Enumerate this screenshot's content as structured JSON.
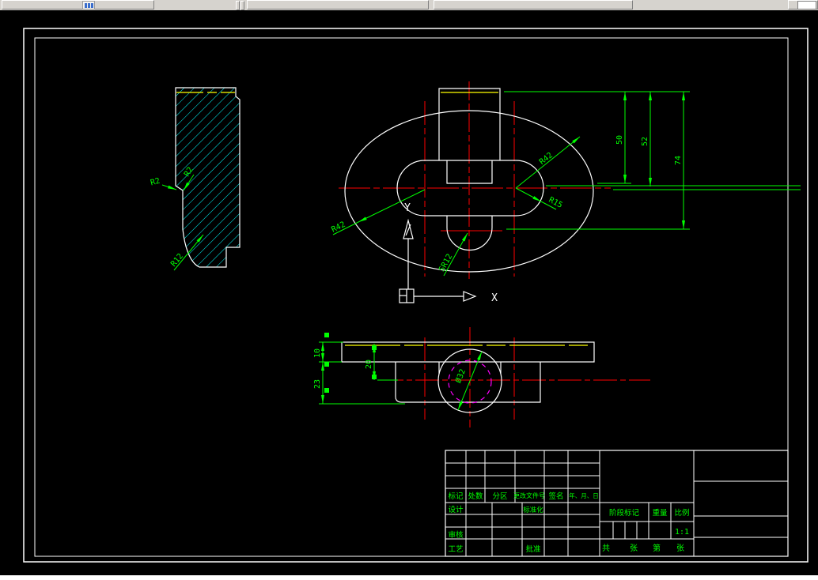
{
  "dims": {
    "sec_r2a": "R2",
    "sec_r2b": "R2",
    "sec_r12": "R12",
    "tv_r42_upper": "R42",
    "tv_r42_lower": "R42",
    "tv_r15": "R15",
    "tv_sr12": "SR12",
    "tv_50": "50",
    "tv_52": "52",
    "tv_74": "74",
    "bv_10": "10",
    "bv_23": "23",
    "bv_20": "20",
    "bv_dia": "Ø32"
  },
  "ucs": {
    "x": "X",
    "y": "Y"
  },
  "title_block": {
    "header": [
      "标记",
      "处数",
      "分区",
      "更改文件号",
      "签名",
      "年、月、日"
    ],
    "design": "设计",
    "standardization": "标准化",
    "check": "审核",
    "process": "工艺",
    "approve": "批准",
    "stage_mark": "阶段标记",
    "weight": "重量",
    "scale_label": "比例",
    "scale_value": "1:1",
    "total": "共",
    "sheet1": "张",
    "ordinal": "第",
    "sheet2": "张"
  },
  "colors": {
    "outline": "#ffffff",
    "dimension": "#00ff00",
    "centerline": "#ff0000",
    "hatch": "#00ffff",
    "aux": "#ffff00",
    "phantom": "#ff00ff"
  }
}
